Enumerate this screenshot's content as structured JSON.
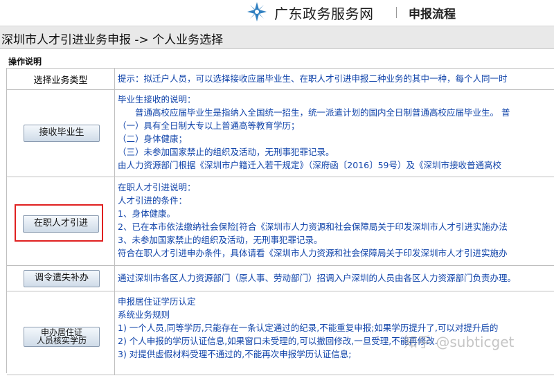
{
  "header": {
    "site_name": "广东政务服务网",
    "flow_title": "申报流程"
  },
  "page_title": "深圳市人才引进业务申报 -> 个人业务选择",
  "section_title": "操作说明",
  "table": {
    "select_label": "选择业务类型",
    "hint": "提示：拟迁户人员，可以选择接收应届毕业生、在职人才引进申报二种业务的其中一种，每个人同一时",
    "rows": [
      {
        "button": "接收毕业生",
        "lines": [
          "毕业生接收的说明：",
          "　　普通高校应届毕业生是指纳入全国统一招生，统一派遣计划的国内全日制普通高校应届毕业生。 普",
          "（一）具有全日制大专以上普通高等教育学历；",
          "（二）身体健康；",
          "（三）未参加国家禁止的组织及活动，无刑事犯罪记录。",
          "由人力资源部门根据《深圳市户籍迁入若干规定》（深府函〔2016〕59号）及《深圳市接收普通高校"
        ]
      },
      {
        "button": "在职人才引进",
        "lines": [
          "在职人才引进说明：",
          "人才引进的条件：",
          "1、身体健康。",
          "2、已在本市依法缴纳社会保险[符合《深圳市人力资源和社会保障局关于印发深圳市人才引进实施办法",
          "3、未参加国家禁止的组织及活动，无刑事犯罪记录。",
          "符合在职人才引进申办条件，具体请看《深圳市人力资源和社会保障局关于印发深圳市人才引进实施办"
        ]
      },
      {
        "button": "调令遗失补办",
        "lines": [
          "通过深圳市各区人力资源部门（原人事、劳动部门）招调入户深圳的人员由各区人力资源部门负责办理。"
        ]
      },
      {
        "button_line1": "申办居住证",
        "button_line2": "人员核实学历",
        "lines": [
          "申报居住证学历认定",
          "系统业务规则",
          "  1) 一个人员,同等学历,只能存在一条认定通过的纪录,不能重复申报;如果学历提升了,可以对提升后的",
          "  2) 个人申报的学历认证信息,如果窗口未受理的,可以撤回修改,一旦受理,不能再修改.",
          "  3) 对提供虚假材料受理不通过的,不能再次申报学历认证信息;"
        ]
      }
    ]
  },
  "watermark": "知乎 @subticget",
  "colors": {
    "logo": "#2f7fc0",
    "highlight": "#e02020",
    "link_text": "#1144aa"
  }
}
